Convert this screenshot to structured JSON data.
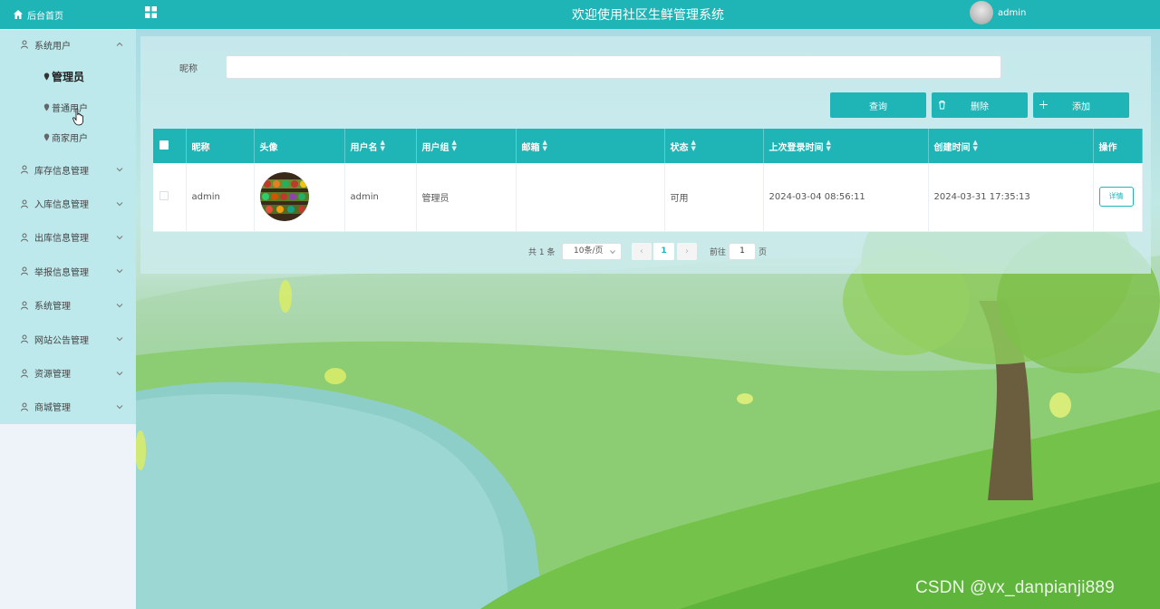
{
  "header": {
    "home_label": "后台首页",
    "title": "欢迎使用社区生鲜管理系统",
    "username": "admin"
  },
  "sidebar": {
    "groups": [
      {
        "label": "系统用户",
        "icon": "user-icon",
        "expanded": true,
        "children": [
          {
            "label": "管理员",
            "active": true
          },
          {
            "label": "普通用户"
          },
          {
            "label": "商家用户"
          }
        ]
      },
      {
        "label": "库存信息管理",
        "icon": "user-icon"
      },
      {
        "label": "入库信息管理",
        "icon": "user-icon"
      },
      {
        "label": "出库信息管理",
        "icon": "user-icon"
      },
      {
        "label": "举报信息管理",
        "icon": "user-icon"
      },
      {
        "label": "系统管理",
        "icon": "user-icon"
      },
      {
        "label": "网站公告管理",
        "icon": "user-icon"
      },
      {
        "label": "资源管理",
        "icon": "user-icon"
      },
      {
        "label": "商城管理",
        "icon": "user-icon"
      }
    ]
  },
  "search": {
    "nickname_label": "昵称",
    "nickname_value": ""
  },
  "actions": {
    "query": "查询",
    "delete": "删除",
    "add": "添加"
  },
  "table": {
    "headers": [
      "昵称",
      "头像",
      "用户名",
      "用户组",
      "邮箱",
      "状态",
      "上次登录时间",
      "创建时间",
      "操作"
    ],
    "rows": [
      {
        "nickname": "admin",
        "avatar": "produce-shelf-image",
        "username": "admin",
        "group": "管理员",
        "email": "",
        "status": "可用",
        "last_login": "2024-03-04 08:56:11",
        "created": "2024-03-31 17:35:13",
        "action": "详情"
      }
    ]
  },
  "pagination": {
    "total": "共 1 条",
    "page_size": "10条/页",
    "prev": "‹",
    "current": "1",
    "next": "›",
    "goto_label": "前往",
    "goto_value": "1",
    "page_suffix": "页"
  },
  "watermark": "CSDN @vx_danpianji889",
  "colors": {
    "primary": "#1fb4b6",
    "sidebar_bg": "#bde9ec"
  }
}
